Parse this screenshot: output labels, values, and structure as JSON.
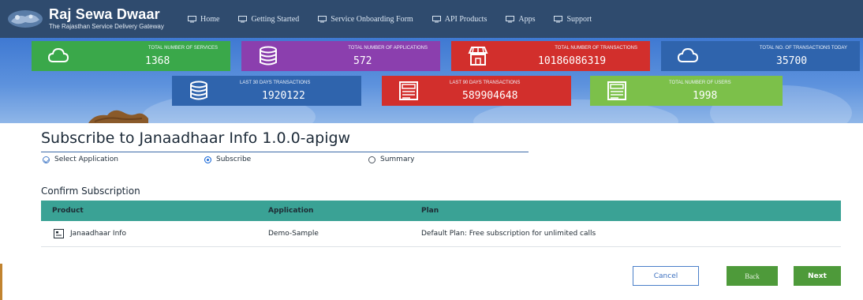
{
  "brand": {
    "title": "Raj Sewa Dwaar",
    "subtitle": "The Rajasthan Service Delivery Gateway"
  },
  "nav": {
    "items": [
      {
        "label": "Home",
        "icon": "monitor-icon"
      },
      {
        "label": "Getting Started",
        "icon": "monitor-icon"
      },
      {
        "label": "Service Onboarding Form",
        "icon": "monitor-icon"
      },
      {
        "label": "API Products",
        "icon": "monitor-icon"
      },
      {
        "label": "Apps",
        "icon": "monitor-icon"
      },
      {
        "label": "Support",
        "icon": "monitor-icon"
      }
    ]
  },
  "stats": [
    {
      "label": "TOTAL NUMBER OF SERVICES",
      "value": "1368",
      "color": "#3aa84a",
      "icon": "cloud-icon"
    },
    {
      "label": "TOTAL NUMBER OF APPLICATIONS",
      "value": "572",
      "color": "#8b3fae",
      "icon": "database-icon"
    },
    {
      "label": "TOTAL NUMBER OF TRANSACTIONS",
      "value": "10186086319",
      "color": "#d22f2c",
      "icon": "store-icon"
    },
    {
      "label": "TOTAL NO. OF TRANSACTIONS TODAY",
      "value": "35700",
      "color": "#2f64ad",
      "icon": "cloud-icon"
    },
    {
      "label": "LAST 30 DAYS TRANSACTIONS",
      "value": "1920122",
      "color": "#2f64ad",
      "icon": "database-icon"
    },
    {
      "label": "LAST 90 DAYS TRANSACTIONS",
      "value": "589904648",
      "color": "#d22f2c",
      "icon": "document-icon"
    },
    {
      "label": "TOTAL NUMBER OF USERS",
      "value": "1998",
      "color": "#7cc04a",
      "icon": "document-icon"
    }
  ],
  "page": {
    "title": "Subscribe to Janaadhaar Info 1.0.0-apigw"
  },
  "steps": [
    {
      "label": "Select Application",
      "state": "done"
    },
    {
      "label": "Subscribe",
      "state": "active"
    },
    {
      "label": "Summary",
      "state": "pending"
    }
  ],
  "confirm": {
    "title": "Confirm Subscription",
    "columns": [
      "Product",
      "Application",
      "Plan"
    ],
    "rows": [
      {
        "product": "Janaadhaar Info",
        "application": "Demo-Sample",
        "plan": "Default Plan: Free subscription for unlimited calls"
      }
    ]
  },
  "actions": {
    "cancel": "Cancel",
    "back": "Back",
    "next": "Next"
  },
  "colors": {
    "nav_bg": "#2f4b6e",
    "table_header": "#3aa295",
    "primary_green": "#4e9a3a",
    "accent_blue": "#4a7fc9"
  }
}
